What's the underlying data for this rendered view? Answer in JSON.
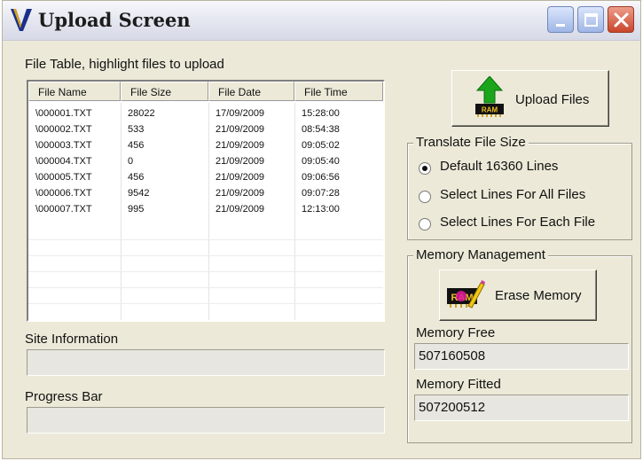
{
  "window": {
    "title": "Upload Screen",
    "logo_letter": "V"
  },
  "titlebar_buttons": [
    "minimize",
    "maximize",
    "close"
  ],
  "file_table": {
    "caption": "File Table, highlight files to upload",
    "columns": [
      "File Name",
      "File Size",
      "File Date",
      "File Time"
    ],
    "rows": [
      [
        "\\000001.TXT",
        "28022",
        "17/09/2009",
        "15:28:00"
      ],
      [
        "\\000002.TXT",
        "533",
        "21/09/2009",
        "08:54:38"
      ],
      [
        "\\000003.TXT",
        "456",
        "21/09/2009",
        "09:05:02"
      ],
      [
        "\\000004.TXT",
        "0",
        "21/09/2009",
        "09:05:40"
      ],
      [
        "\\000005.TXT",
        "456",
        "21/09/2009",
        "09:06:56"
      ],
      [
        "\\000006.TXT",
        "9542",
        "21/09/2009",
        "09:07:28"
      ],
      [
        "\\000007.TXT",
        "995",
        "21/09/2009",
        "12:13:00"
      ]
    ]
  },
  "site_information": {
    "label": "Site Information",
    "value": ""
  },
  "progress_bar": {
    "label": "Progress Bar",
    "value": 0
  },
  "upload_button": {
    "label": "Upload Files",
    "icon_text": "RAM",
    "icon": "upload-ram-icon"
  },
  "translate_group": {
    "title": "Translate File Size",
    "options": [
      {
        "label": "Default 16360 Lines",
        "selected": true
      },
      {
        "label": "Select Lines For All Files",
        "selected": false
      },
      {
        "label": "Select Lines For Each File",
        "selected": false
      }
    ]
  },
  "memory_group": {
    "title": "Memory Management",
    "erase_button": {
      "label": "Erase Memory",
      "icon_text": "RAM",
      "icon": "erase-ram-icon"
    },
    "free_label": "Memory Free",
    "free_value": "507160508",
    "fitted_label": "Memory Fitted",
    "fitted_value": "507200512"
  },
  "colors": {
    "window_bg": "#ece9d8",
    "arrow_green": "#1aa51a",
    "close_red": "#d14b31",
    "logo_blue": "#1a2f8a",
    "logo_gold": "#d7a21b"
  }
}
